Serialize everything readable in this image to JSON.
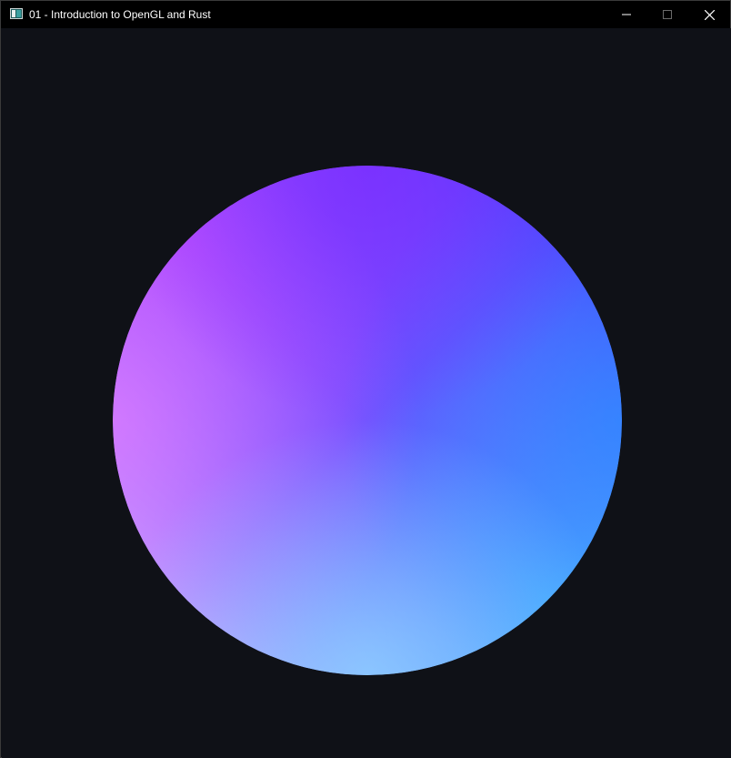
{
  "window": {
    "title": "01 - Introduction to OpenGL and Rust",
    "icon": "app-window-icon",
    "controls": {
      "minimize_icon": "minimize-icon",
      "maximize_icon": "maximize-icon",
      "close_icon": "close-icon"
    }
  },
  "canvas": {
    "background_color": "#0f1117",
    "shape": "sphere",
    "gradient_colors": {
      "top_left": "#c040ff",
      "top_right": "#5a30ff",
      "right": "#2a90ff",
      "bottom_right": "#50d8ff",
      "bottom_left": "#d8c8ff",
      "left": "#e080ff",
      "top": "#8030ff"
    }
  }
}
